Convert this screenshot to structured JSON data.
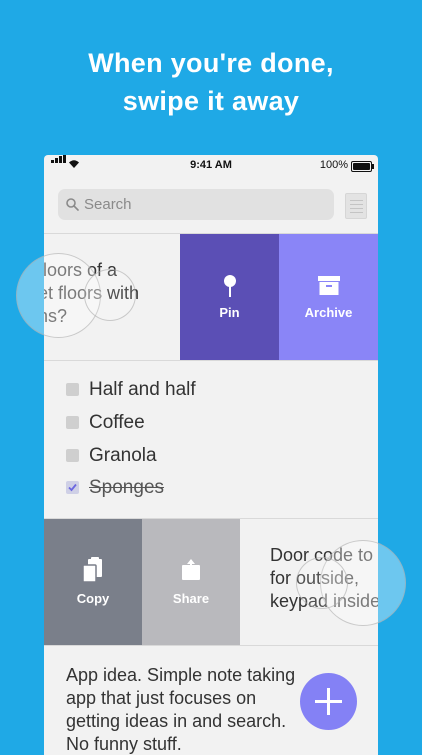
{
  "headline": {
    "line1": "When you're done,",
    "line2": "swipe it away"
  },
  "status_bar": {
    "time": "9:41 AM",
    "battery": "100%"
  },
  "search": {
    "placeholder": "Search"
  },
  "note1": {
    "lines": [
      "floors of a",
      "et floors with",
      "ns?"
    ]
  },
  "note1_actions": {
    "pin": "Pin",
    "archive": "Archive"
  },
  "checklist": {
    "items": [
      {
        "label": "Half and half",
        "checked": false
      },
      {
        "label": "Coffee",
        "checked": false
      },
      {
        "label": "Granola",
        "checked": false
      },
      {
        "label": "Sponges",
        "checked": true
      }
    ]
  },
  "note2_actions": {
    "copy": "Copy",
    "share": "Share"
  },
  "note2": {
    "lines": [
      "Door code to",
      "for outside,",
      "keypad inside"
    ]
  },
  "note3": {
    "lines": [
      "App idea. Simple note taking",
      "app that just focuses on",
      "getting ideas in and search.",
      "No funny stuff."
    ]
  },
  "colors": {
    "background": "#1fa9e6",
    "pin": "#5b4fb5",
    "archive": "#8a85f7",
    "copy": "#7a7f8a",
    "share": "#b9b9bd",
    "fab": "#8481f5"
  },
  "icons": {
    "search": "search-icon",
    "pin": "pin-icon",
    "archive": "archive-box-icon",
    "copy": "copy-clipboard-icon",
    "share": "share-icon",
    "add": "plus-icon"
  }
}
